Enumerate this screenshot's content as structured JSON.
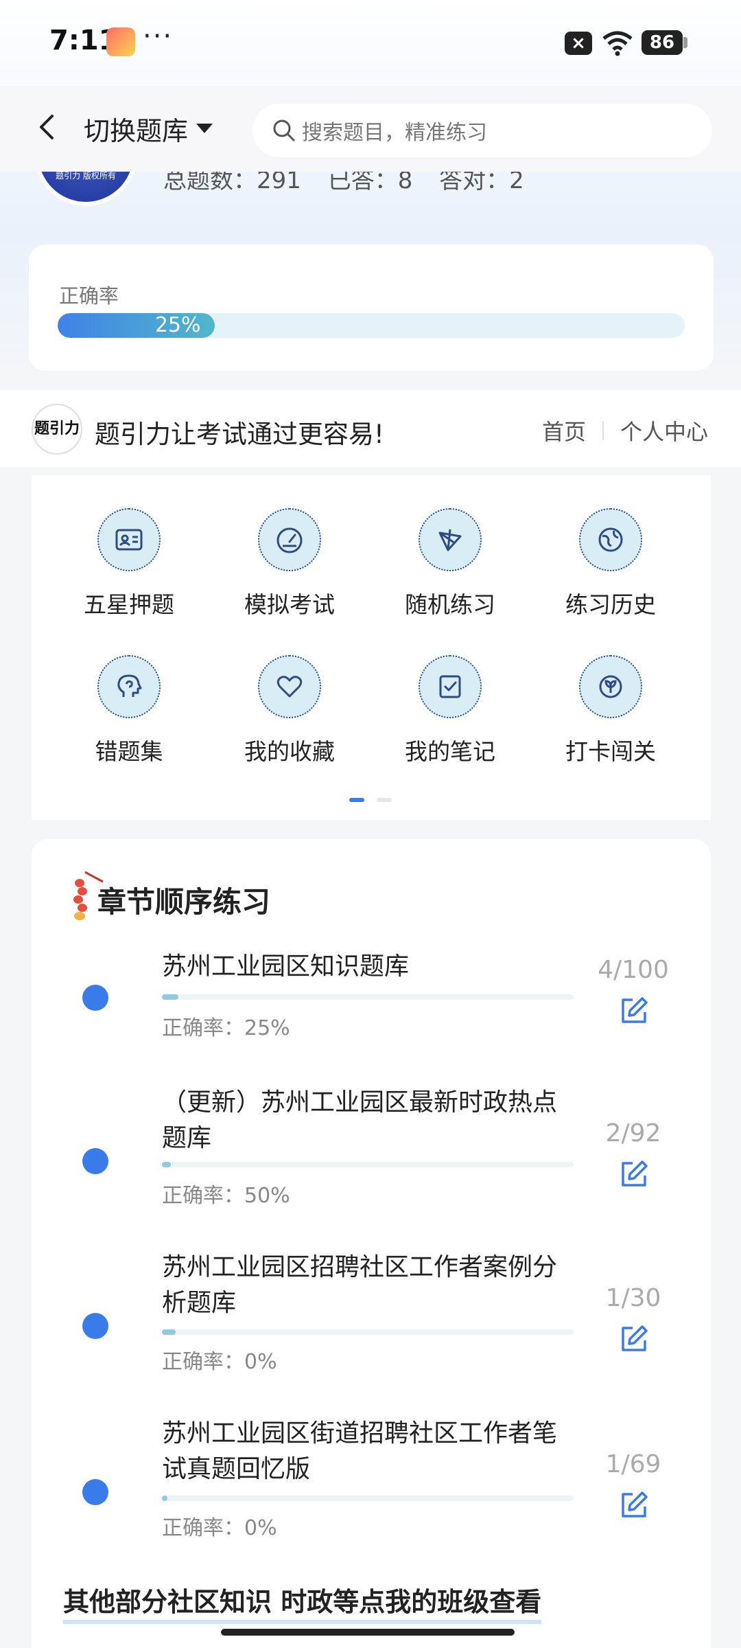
{
  "status_bar": {
    "time": "7:11",
    "more": "···",
    "battery": "86"
  },
  "header": {
    "bank_switch_label": "切换题库",
    "search_placeholder": "搜索题目，精准练习"
  },
  "avatar_text": "题引力 版权所有",
  "stats": {
    "total": "总题数：291",
    "answered": "已答：8",
    "correct": "答对：2"
  },
  "accuracy": {
    "label": "正确率",
    "value_text": "25%",
    "value": 0.25
  },
  "brand": {
    "logo_text": "题引力",
    "slogan": "题引力让考试通过更容易!",
    "links": [
      "首页",
      "个人中心"
    ]
  },
  "features": [
    {
      "label": "五星押题",
      "icon": "id-card-icon"
    },
    {
      "label": "模拟考试",
      "icon": "speedometer-icon"
    },
    {
      "label": "随机练习",
      "icon": "shuffle-icon"
    },
    {
      "label": "练习历史",
      "icon": "globe-icon"
    },
    {
      "label": "错题集",
      "icon": "head-icon"
    },
    {
      "label": "我的收藏",
      "icon": "heart-icon"
    },
    {
      "label": "我的笔记",
      "icon": "note-check-icon"
    },
    {
      "label": "打卡闯关",
      "icon": "sprout-icon"
    }
  ],
  "colors": {
    "accent": "#3a7bea",
    "pager_active": "#3a7bea",
    "pager_inactive": "#e8e8e8"
  },
  "chapter": {
    "title": "章节顺序练习",
    "items": [
      {
        "name": "苏州工业园区知识题库",
        "count": "4/100",
        "rate": "正确率：25%",
        "progress": 0.04
      },
      {
        "name": "（更新）苏州工业园区最新时政热点题库",
        "count": "2/92",
        "rate": "正确率：50%",
        "progress": 0.022
      },
      {
        "name": "苏州工业园区招聘社区工作者案例分析题库",
        "count": "1/30",
        "rate": "正确率：0%",
        "progress": 0.033
      },
      {
        "name": "苏州工业园区街道招聘社区工作者笔试真题回忆版",
        "count": "1/69",
        "rate": "正确率：0%",
        "progress": 0.014
      }
    ],
    "footer_link": "其他部分社区知识 时政等点我的班级查看"
  }
}
